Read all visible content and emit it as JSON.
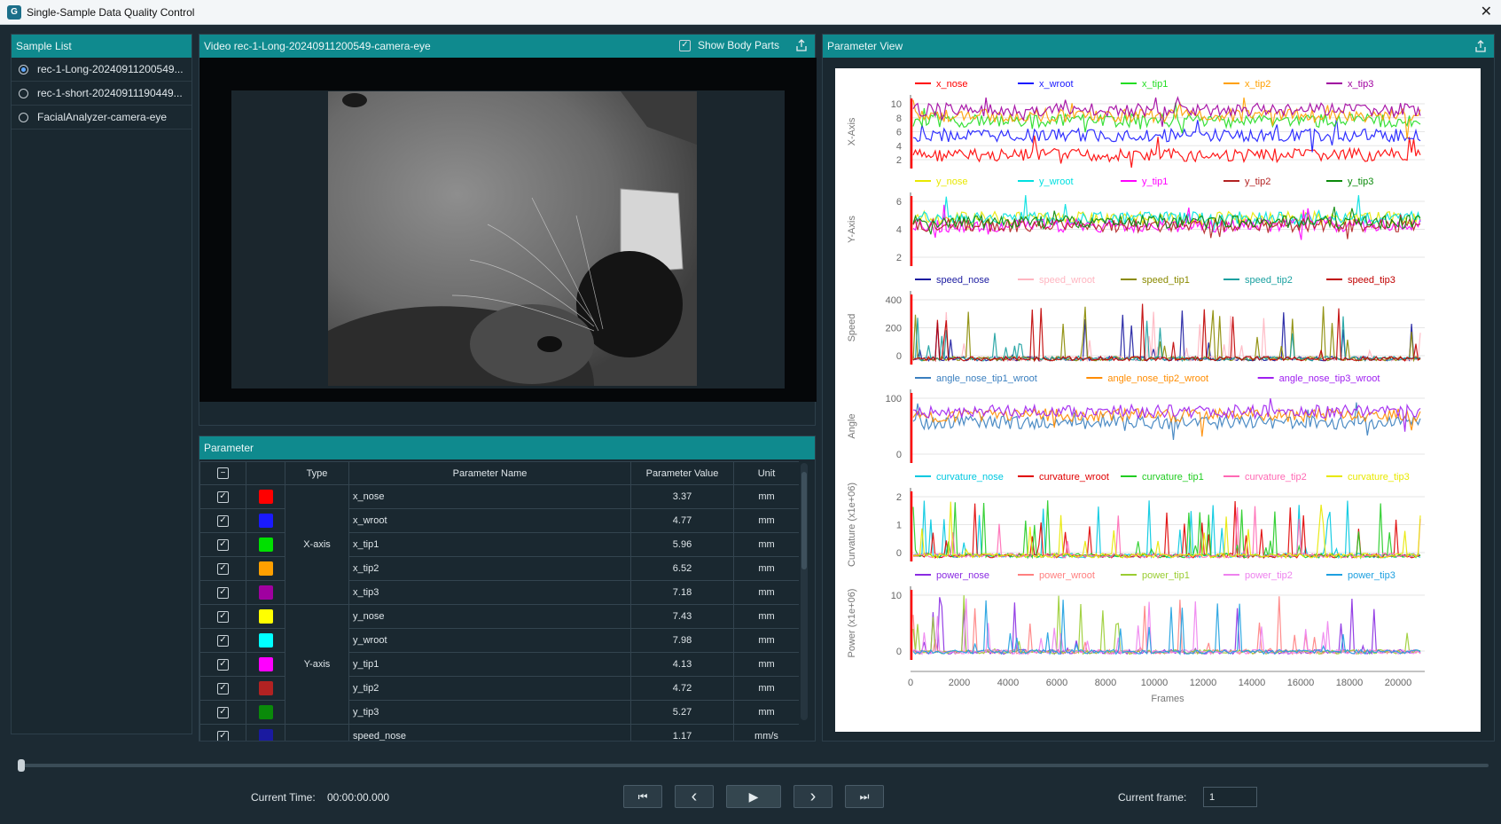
{
  "window": {
    "title": "Single-Sample Data Quality Control",
    "icon": "app-logo-icon",
    "close": "✕"
  },
  "sample_list": {
    "title": "Sample List",
    "items": [
      {
        "label": "rec-1-Long-20240911200549...",
        "selected": true
      },
      {
        "label": "rec-1-short-20240911190449...",
        "selected": false
      },
      {
        "label": "FacialAnalyzer-camera-eye",
        "selected": false
      }
    ]
  },
  "video": {
    "title": "Video rec-1-Long-20240911200549-camera-eye",
    "show_body_parts_label": "Show Body Parts",
    "show_body_parts_checked": true
  },
  "parameter": {
    "title": "Parameter",
    "columns": {
      "type": "Type",
      "name": "Parameter Name",
      "value": "Parameter Value",
      "unit": "Unit"
    },
    "groups": {
      "x": "X-axis",
      "y": "Y-axis"
    },
    "rows": [
      {
        "name": "x_nose",
        "value": "3.37",
        "unit": "mm",
        "color": "#ff0000"
      },
      {
        "name": "x_wroot",
        "value": "4.77",
        "unit": "mm",
        "color": "#1a1aff"
      },
      {
        "name": "x_tip1",
        "value": "5.96",
        "unit": "mm",
        "color": "#00e000"
      },
      {
        "name": "x_tip2",
        "value": "6.52",
        "unit": "mm",
        "color": "#ffa000"
      },
      {
        "name": "x_tip3",
        "value": "7.18",
        "unit": "mm",
        "color": "#a000a0"
      },
      {
        "name": "y_nose",
        "value": "7.43",
        "unit": "mm",
        "color": "#ffff00"
      },
      {
        "name": "y_wroot",
        "value": "7.98",
        "unit": "mm",
        "color": "#00ffff"
      },
      {
        "name": "y_tip1",
        "value": "4.13",
        "unit": "mm",
        "color": "#ff00ff"
      },
      {
        "name": "y_tip2",
        "value": "4.72",
        "unit": "mm",
        "color": "#b22222"
      },
      {
        "name": "y_tip3",
        "value": "5.27",
        "unit": "mm",
        "color": "#0a8a0a"
      },
      {
        "name": "speed_nose",
        "value": "1.17",
        "unit": "mm/s",
        "color": "#1a1aa0"
      }
    ]
  },
  "parameter_view": {
    "title": "Parameter View",
    "x_axis_label": "Frames",
    "x_ticks": [
      "0",
      "2000",
      "4000",
      "6000",
      "8000",
      "10000",
      "12000",
      "14000",
      "16000",
      "18000",
      "20000"
    ],
    "panels": [
      {
        "ylabel": "X-Axis",
        "ticks": [
          "10",
          "8",
          "6",
          "4",
          "2"
        ],
        "series": [
          {
            "name": "x_nose",
            "color": "#ff0000"
          },
          {
            "name": "x_wroot",
            "color": "#1a1aff"
          },
          {
            "name": "x_tip1",
            "color": "#22dd22"
          },
          {
            "name": "x_tip2",
            "color": "#ffa000"
          },
          {
            "name": "x_tip3",
            "color": "#a000a0"
          }
        ]
      },
      {
        "ylabel": "Y-Axis",
        "ticks": [
          "6",
          "4",
          "2"
        ],
        "series": [
          {
            "name": "y_nose",
            "color": "#e8e800"
          },
          {
            "name": "y_wroot",
            "color": "#00e0e0"
          },
          {
            "name": "y_tip1",
            "color": "#ff00ff"
          },
          {
            "name": "y_tip2",
            "color": "#b22222"
          },
          {
            "name": "y_tip3",
            "color": "#0a8a0a"
          }
        ]
      },
      {
        "ylabel": "Speed",
        "ticks": [
          "400",
          "200",
          "0"
        ],
        "series": [
          {
            "name": "speed_nose",
            "color": "#1a1aa0"
          },
          {
            "name": "speed_wroot",
            "color": "#ffb6c1"
          },
          {
            "name": "speed_tip1",
            "color": "#8a8a00"
          },
          {
            "name": "speed_tip2",
            "color": "#1aa0a0"
          },
          {
            "name": "speed_tip3",
            "color": "#c00000"
          }
        ]
      },
      {
        "ylabel": "Angle",
        "ticks": [
          "100",
          "0"
        ],
        "series": [
          {
            "name": "angle_nose_tip1_wroot",
            "color": "#3a7fbf"
          },
          {
            "name": "angle_nose_tip2_wroot",
            "color": "#ff8c00"
          },
          {
            "name": "angle_nose_tip3_wroot",
            "color": "#a020f0"
          }
        ]
      },
      {
        "ylabel": "Curvature (x1e+06)",
        "ticks": [
          "2",
          "1",
          "0"
        ],
        "series": [
          {
            "name": "curvature_nose",
            "color": "#00c8e0"
          },
          {
            "name": "curvature_wroot",
            "color": "#e00000"
          },
          {
            "name": "curvature_tip1",
            "color": "#22cc22"
          },
          {
            "name": "curvature_tip2",
            "color": "#ff69b4"
          },
          {
            "name": "curvature_tip3",
            "color": "#e8e800"
          }
        ]
      },
      {
        "ylabel": "Power (x1e+06)",
        "ticks": [
          "10",
          "0"
        ],
        "series": [
          {
            "name": "power_nose",
            "color": "#8a2be2"
          },
          {
            "name": "power_wroot",
            "color": "#ff8080"
          },
          {
            "name": "power_tip1",
            "color": "#9acd32"
          },
          {
            "name": "power_tip2",
            "color": "#ee82ee"
          },
          {
            "name": "power_tip3",
            "color": "#1ea0e0"
          }
        ]
      }
    ]
  },
  "playback": {
    "current_time_label": "Current Time:",
    "current_time": "00:00:00.000",
    "current_frame_label": "Current frame:",
    "current_frame": "1",
    "buttons": {
      "first": "⏮",
      "prev": "‹",
      "play": "▶",
      "next": "›",
      "last": "⏭"
    }
  }
}
